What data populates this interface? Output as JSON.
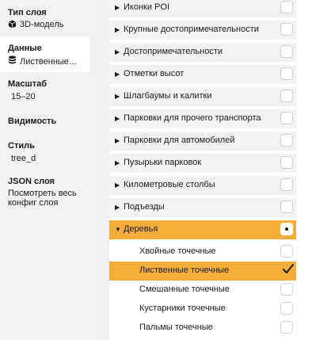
{
  "sidebar": {
    "layer_type": {
      "label": "Тип слоя",
      "value": "3D-модель",
      "icon": "cube-icon"
    },
    "data": {
      "label": "Данные",
      "value": "Лиственные точечные",
      "icon": "database-icon"
    },
    "scale": {
      "label": "Масштаб",
      "value": "15–20"
    },
    "visibility": {
      "label": "Видимость"
    },
    "style": {
      "label": "Стиль",
      "value": "tree_d"
    },
    "json": {
      "label": "JSON слоя",
      "link": "Посмотреть весь конфиг слоя"
    }
  },
  "layers": [
    {
      "label": "Иконки POI"
    },
    {
      "label": "Крупные достопримечательности"
    },
    {
      "label": "Достопримечательности"
    },
    {
      "label": "Отметки высот"
    },
    {
      "label": "Шлагбаумы и калитки"
    },
    {
      "label": "Парковки для прочего транспорта"
    },
    {
      "label": "Парковки для автомобилей"
    },
    {
      "label": "Пузырьки парковок"
    },
    {
      "label": "Километровые столбы"
    },
    {
      "label": "Подъезды"
    },
    {
      "label": "Деревья",
      "expanded": true,
      "state": "partial"
    }
  ],
  "tree_sublayers": [
    {
      "label": "Хвойные точечные",
      "checked": false
    },
    {
      "label": "Лиственные точечные",
      "checked": true
    },
    {
      "label": "Смешанные точечные",
      "checked": false
    },
    {
      "label": "Кустарники точечные",
      "checked": false
    },
    {
      "label": "Пальмы точечные",
      "checked": false
    }
  ],
  "colors": {
    "accent": "#f5ad3a",
    "sidebar_bg": "#f2f2f2",
    "row_bg": "#f2f2f2"
  }
}
